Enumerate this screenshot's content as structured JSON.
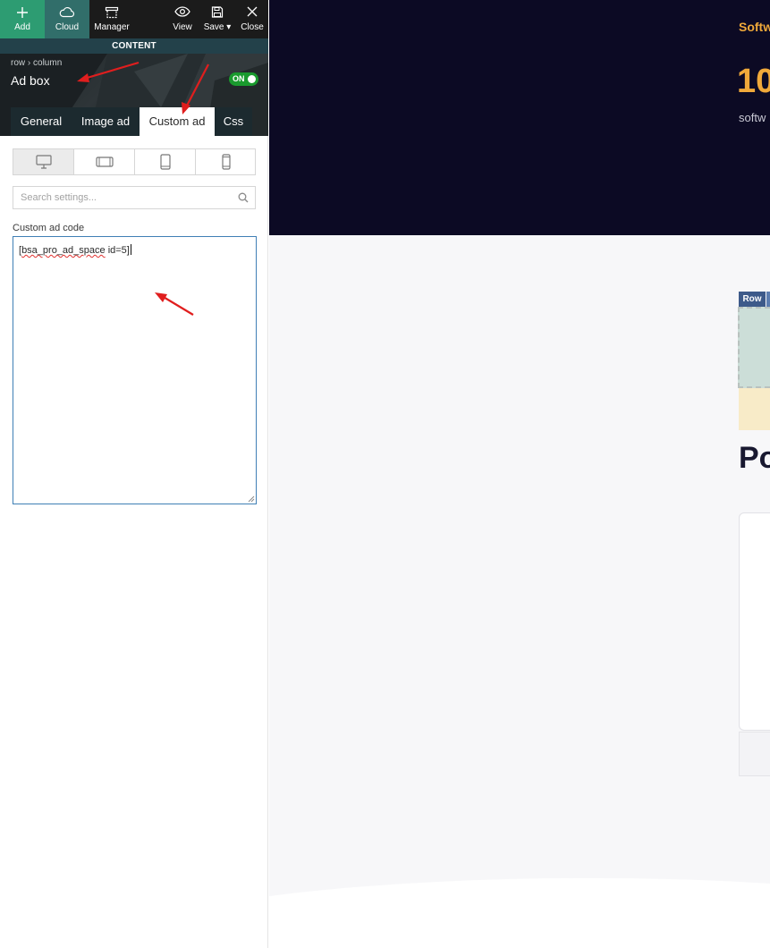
{
  "toolbar": {
    "add_label": "Add",
    "cloud_label": "Cloud",
    "manager_label": "Manager",
    "view_label": "View",
    "save_label": "Save",
    "close_label": "Close"
  },
  "section_label": "CONTENT",
  "header": {
    "breadcrumb_row": "row",
    "breadcrumb_column": "column",
    "title": "Ad box",
    "toggle_label": "ON"
  },
  "tabs": [
    {
      "label": "General"
    },
    {
      "label": "Image ad"
    },
    {
      "label": "Custom ad",
      "active": true
    },
    {
      "label": "Css"
    }
  ],
  "devices": [
    "desktop-icon",
    "tablet-landscape-icon",
    "tablet-portrait-icon",
    "mobile-icon"
  ],
  "search": {
    "placeholder": "Search settings..."
  },
  "custom_ad": {
    "label": "Custom ad code",
    "code_prefix": "[",
    "code_squiggle": "bsa_pro_ad_space",
    "code_suffix": " id=5]"
  },
  "preview": {
    "kicker": "Softw",
    "big_number": "10",
    "subtitle": "softw",
    "row_badge": "Row",
    "heading": "Po"
  },
  "colors": {
    "accent_green": "#2d9c72",
    "hero_bg": "#0c0a24",
    "hero_accent": "#f0a93a",
    "arrow_red": "#e01e1e"
  }
}
